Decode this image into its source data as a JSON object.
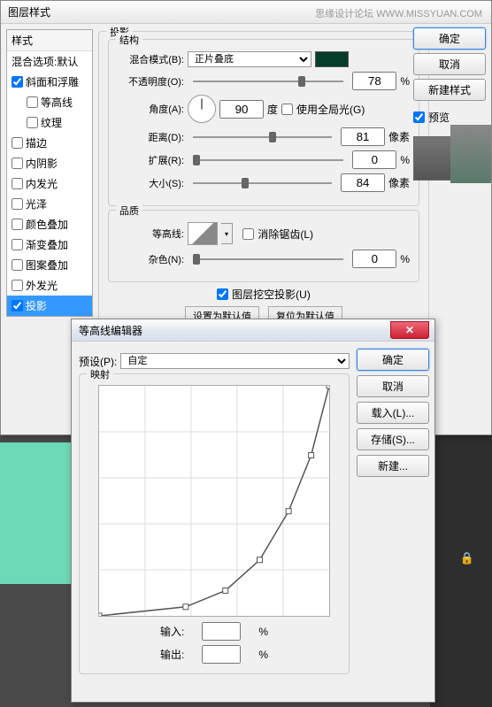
{
  "win1": {
    "title": "图层样式",
    "watermark": "思缘设计论坛  WWW.MISSYUAN.COM"
  },
  "styles": {
    "header": "样式",
    "blend": "混合选项:默认",
    "items": [
      {
        "label": "斜面和浮雕",
        "checked": true
      },
      {
        "label": "等高线",
        "sub": true,
        "checked": false
      },
      {
        "label": "纹理",
        "sub": true,
        "checked": false
      },
      {
        "label": "描边",
        "checked": false
      },
      {
        "label": "内阴影",
        "checked": false
      },
      {
        "label": "内发光",
        "checked": false
      },
      {
        "label": "光泽",
        "checked": false
      },
      {
        "label": "颜色叠加",
        "checked": false
      },
      {
        "label": "渐变叠加",
        "checked": false
      },
      {
        "label": "图案叠加",
        "checked": false
      },
      {
        "label": "外发光",
        "checked": false
      },
      {
        "label": "投影",
        "checked": true,
        "selected": true
      }
    ]
  },
  "panel": {
    "title": "投影",
    "structure": {
      "legend": "结构",
      "blendmode_label": "混合模式(B):",
      "blendmode_value": "正片叠底",
      "opacity_label": "不透明度(O):",
      "opacity_value": "78",
      "opacity_unit": "%",
      "angle_label": "角度(A):",
      "angle_value": "90",
      "angle_unit": "度",
      "global_label": "使用全局光(G)",
      "distance_label": "距离(D):",
      "distance_value": "81",
      "distance_unit": "像素",
      "spread_label": "扩展(R):",
      "spread_value": "0",
      "spread_unit": "%",
      "size_label": "大小(S):",
      "size_value": "84",
      "size_unit": "像素",
      "swatch_color": "#063d2a"
    },
    "quality": {
      "legend": "品质",
      "contour_label": "等高线:",
      "antialias_label": "消除锯齿(L)",
      "noise_label": "杂色(N):",
      "noise_value": "0",
      "noise_unit": "%"
    },
    "knockout_label": "图层挖空投影(U)",
    "reset1": "设置为默认值",
    "reset2": "复位为默认值"
  },
  "rbtns": {
    "ok": "确定",
    "cancel": "取消",
    "newstyle": "新建样式",
    "preview": "预览"
  },
  "win2": {
    "title": "等高线编辑器",
    "preset_label": "预设(P):",
    "preset_value": "自定",
    "map_label": "映射",
    "input_label": "输入:",
    "output_label": "输出:",
    "unit": "%",
    "buttons": {
      "ok": "确定",
      "cancel": "取消",
      "load": "载入(L)...",
      "save": "存储(S)...",
      "new": "新建..."
    }
  },
  "chart_data": {
    "type": "line",
    "title": "映射",
    "xlabel": "输入",
    "ylabel": "输出",
    "xlim": [
      0,
      255
    ],
    "ylim": [
      0,
      255
    ],
    "points": [
      [
        0,
        0
      ],
      [
        96,
        10
      ],
      [
        140,
        28
      ],
      [
        178,
        62
      ],
      [
        210,
        116
      ],
      [
        235,
        178
      ],
      [
        255,
        255
      ]
    ]
  },
  "misc": {
    "pct_label": "%",
    "lock": "🔒"
  }
}
